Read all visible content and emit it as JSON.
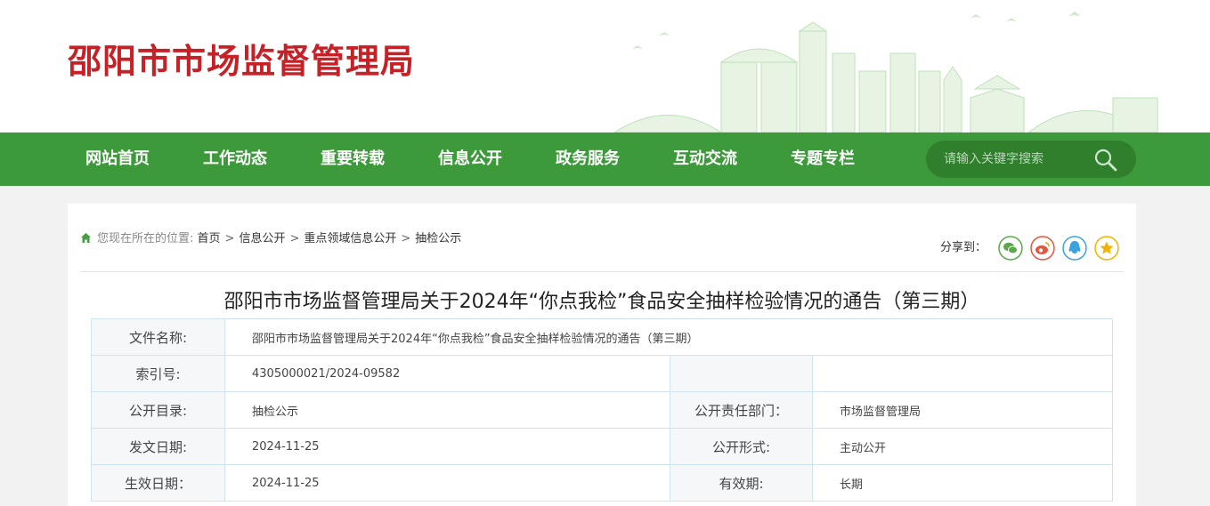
{
  "site": {
    "title": "邵阳市市场监督管理局"
  },
  "nav": {
    "items": [
      "网站首页",
      "工作动态",
      "重要转载",
      "信息公开",
      "政务服务",
      "互动交流",
      "专题专栏"
    ]
  },
  "search": {
    "placeholder": "请输入关键字搜索",
    "icon": "search-icon"
  },
  "breadcrumb": {
    "prefix": "您现在所在的位置:",
    "items": [
      "首页",
      "信息公开",
      "重点领域信息公开",
      "抽检公示"
    ],
    "separator": ">"
  },
  "share": {
    "label": "分享到：",
    "targets": [
      {
        "name": "wechat",
        "color": "#5aa84a"
      },
      {
        "name": "weibo",
        "color": "#e4553f"
      },
      {
        "name": "qq",
        "color": "#3aa3df"
      },
      {
        "name": "favorite",
        "color": "#f0b300"
      }
    ]
  },
  "document": {
    "title": "邵阳市市场监督管理局关于2024年“你点我检”食品安全抽样检验情况的通告（第三期）",
    "meta": {
      "file_name_label": "文件名称:",
      "file_name": "邵阳市市场监督管理局关于2024年“你点我检”食品安全抽样检验情况的通告（第三期）",
      "index_label": "索引号:",
      "index": "4305000021/2024-09582",
      "catalog_label": "公开目录:",
      "catalog": "抽检公示",
      "dept_label": "公开责任部门：",
      "dept": "市场监督管理局",
      "issue_date_label": "发文日期:",
      "issue_date": "2024-11-25",
      "form_label": "公开形式:",
      "form": "主动公开",
      "effective_date_label": "生效日期：",
      "effective_date": "2024-11-25",
      "validity_label": "有效期:",
      "validity": "长期"
    }
  },
  "colors": {
    "brand_red": "#c52127",
    "nav_green": "#3d9a3a",
    "search_green": "#2f7f2d",
    "table_border": "#cfe5ee"
  }
}
